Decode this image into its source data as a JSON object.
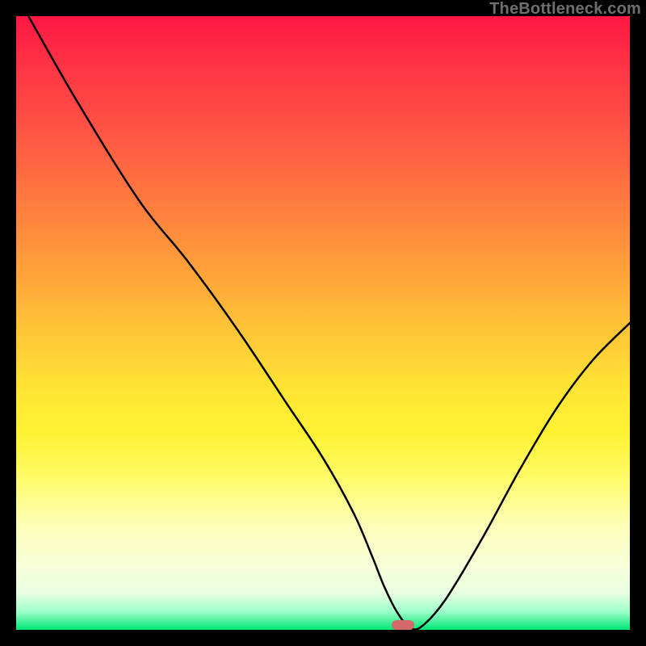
{
  "watermark": "TheBottleneck.com",
  "marker": {
    "x_pct": 63,
    "y_pct": 99.2
  },
  "chart_data": {
    "type": "line",
    "title": "",
    "xlabel": "",
    "ylabel": "",
    "xlim": [
      0,
      100
    ],
    "ylim": [
      0,
      100
    ],
    "grid": false,
    "series": [
      {
        "name": "bottleneck-curve",
        "x": [
          2,
          10,
          20,
          28,
          36,
          44,
          50,
          55,
          58,
          60,
          62,
          64,
          66,
          70,
          76,
          82,
          88,
          94,
          100
        ],
        "y": [
          100,
          86,
          70,
          60,
          49,
          37,
          28,
          19,
          12,
          7,
          3,
          0.5,
          0.5,
          5,
          15,
          26,
          36,
          44,
          50
        ]
      }
    ],
    "annotations": [
      {
        "type": "optimum-marker",
        "x": 63,
        "y": 0.8
      }
    ],
    "background_gradient": {
      "stops": [
        {
          "pct": 0,
          "color": "#ff1744"
        },
        {
          "pct": 50,
          "color": "#ffd633"
        },
        {
          "pct": 85,
          "color": "#ffffcc"
        },
        {
          "pct": 100,
          "color": "#00e676"
        }
      ],
      "direction": "top-to-bottom"
    }
  }
}
